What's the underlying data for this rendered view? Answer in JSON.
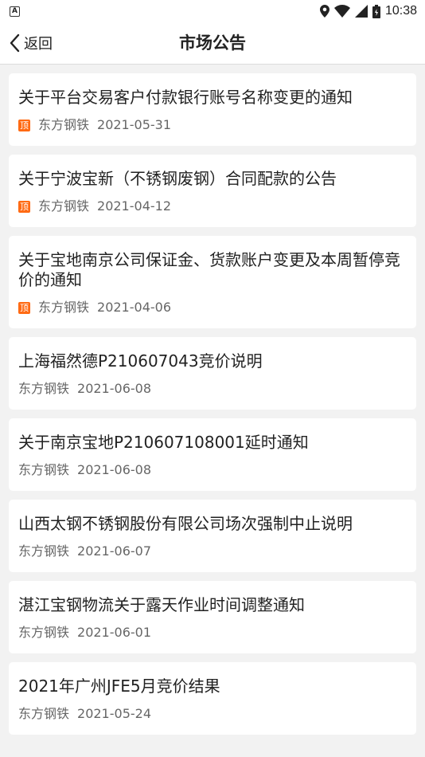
{
  "status_bar": {
    "left_icon": "A",
    "time": "10:38",
    "icons": [
      "location-icon",
      "wifi-icon",
      "signal-icon",
      "battery-icon"
    ]
  },
  "header": {
    "back_label": "返回",
    "title": "市场公告"
  },
  "pin_label": "顶",
  "accent_color": "#ff6a13",
  "announcements": [
    {
      "title": "关于平台交易客户付款银行账号名称变更的通知",
      "pinned": true,
      "source": "东方钢铁",
      "date": "2021-05-31"
    },
    {
      "title": "关于宁波宝新（不锈钢废钢）合同配款的公告",
      "pinned": true,
      "source": "东方钢铁",
      "date": "2021-04-12"
    },
    {
      "title": "关于宝地南京公司保证金、货款账户变更及本周暂停竞价的通知",
      "pinned": true,
      "source": "东方钢铁",
      "date": "2021-04-06"
    },
    {
      "title": "上海福然德P210607043竞价说明",
      "pinned": false,
      "source": "东方钢铁",
      "date": "2021-06-08"
    },
    {
      "title": "关于南京宝地P210607108001延时通知",
      "pinned": false,
      "source": "东方钢铁",
      "date": "2021-06-08"
    },
    {
      "title": "山西太钢不锈钢股份有限公司场次强制中止说明",
      "pinned": false,
      "source": "东方钢铁",
      "date": "2021-06-07"
    },
    {
      "title": "湛江宝钢物流关于露天作业时间调整通知",
      "pinned": false,
      "source": "东方钢铁",
      "date": "2021-06-01"
    },
    {
      "title": "2021年广州JFE5月竞价结果",
      "pinned": false,
      "source": "东方钢铁",
      "date": "2021-05-24"
    }
  ]
}
